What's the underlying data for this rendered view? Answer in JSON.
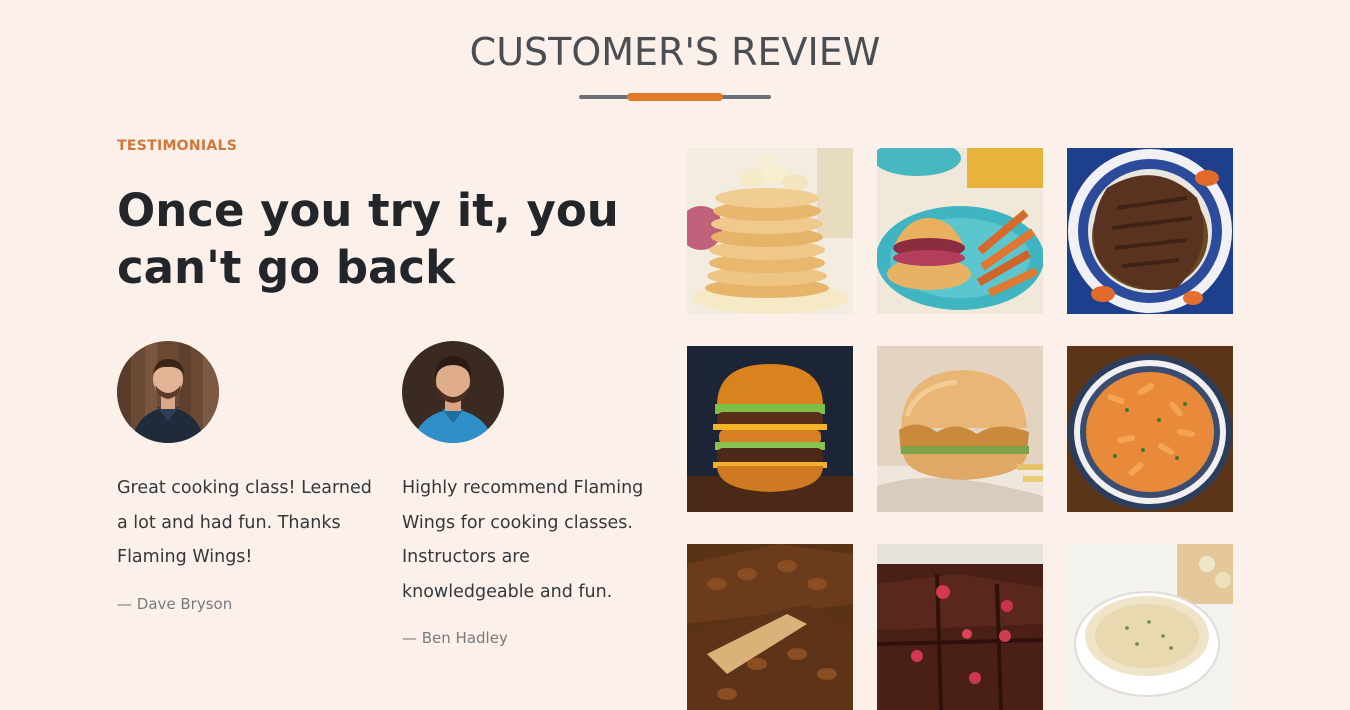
{
  "section": {
    "title": "CUSTOMER'S REVIEW"
  },
  "intro": {
    "eyebrow": "TESTIMONIALS",
    "headline": "Once you try it, you can't go back"
  },
  "testimonials": [
    {
      "quote": "Great cooking class! Learned a lot and had fun. Thanks Flaming Wings!",
      "author": "— Dave Bryson"
    },
    {
      "quote": "Highly recommend Flaming Wings for cooking classes. Instructors are knowledgeable and fun.",
      "author": "— Ben Hadley"
    }
  ],
  "colors": {
    "background": "#fcf1ea",
    "accent": "#e07b2a",
    "eyebrow": "#d2763a",
    "heading": "#222529"
  },
  "gallery": [
    {
      "icon": "pancakes-photo"
    },
    {
      "icon": "pulled-pork-sandwich-photo"
    },
    {
      "icon": "pot-roast-photo"
    },
    {
      "icon": "double-burger-photo"
    },
    {
      "icon": "chicken-sandwich-photo"
    },
    {
      "icon": "pasta-bowl-photo"
    },
    {
      "icon": "pecan-pie-photo"
    },
    {
      "icon": "brownies-photo"
    },
    {
      "icon": "soup-bowl-photo"
    }
  ]
}
